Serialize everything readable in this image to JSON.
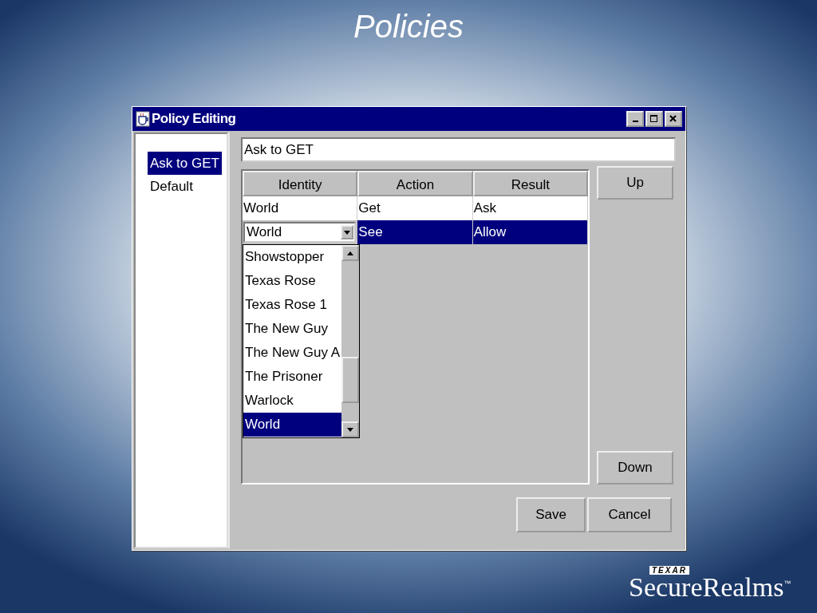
{
  "slide": {
    "title": "Policies"
  },
  "window": {
    "title": "Policy Editing"
  },
  "policies": [
    {
      "label": "Ask to GET",
      "selected": true
    },
    {
      "label": "Default",
      "selected": false
    }
  ],
  "name_field": {
    "value": "Ask to GET"
  },
  "table": {
    "columns": [
      "Identity",
      "Action",
      "Result"
    ],
    "rows": [
      {
        "cells": [
          "World",
          "Get",
          "Ask"
        ],
        "selected": false,
        "editing": false
      },
      {
        "cells": [
          "World",
          "See",
          "Allow"
        ],
        "selected": true,
        "editing": true
      }
    ]
  },
  "identity_dropdown": {
    "items": [
      {
        "label": "Showstopper",
        "selected": false
      },
      {
        "label": "Texas Rose",
        "selected": false
      },
      {
        "label": "Texas Rose 1",
        "selected": false
      },
      {
        "label": "The New Guy",
        "selected": false
      },
      {
        "label": "The New Guy A",
        "selected": false
      },
      {
        "label": "The Prisoner",
        "selected": false
      },
      {
        "label": "Warlock",
        "selected": false
      },
      {
        "label": "World",
        "selected": true
      }
    ]
  },
  "buttons": {
    "up": "Up",
    "down": "Down",
    "save": "Save",
    "cancel": "Cancel"
  },
  "logo": {
    "badge": "TEXAR",
    "name": "SecureRealms",
    "mark": "™"
  }
}
